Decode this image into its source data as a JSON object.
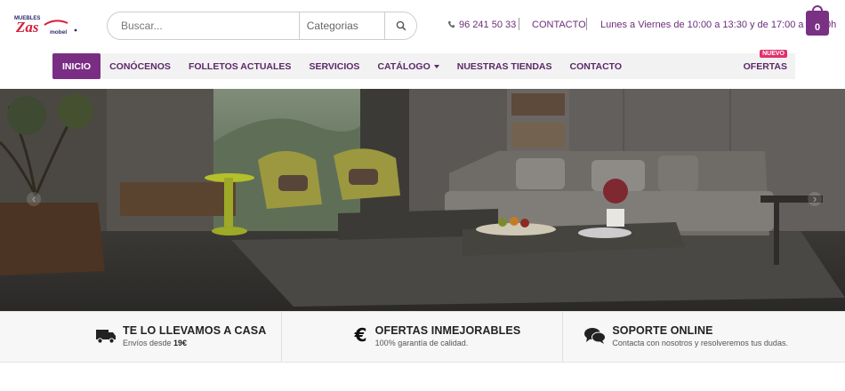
{
  "header": {
    "logo_text": "MUEBLES ZAS MOBEL",
    "search": {
      "placeholder": "Buscar...",
      "category_label": "Categorias"
    },
    "phone": "96 241 50 33",
    "contact_label": "CONTACTO",
    "hours": "Lunes a Viernes de 10:00 a 13:30 y de 17:00 a 20:30h",
    "cart_count": "0"
  },
  "nav": {
    "items": [
      {
        "label": "INICIO",
        "active": true
      },
      {
        "label": "CONÓCENOS"
      },
      {
        "label": "FOLLETOS ACTUALES"
      },
      {
        "label": "SERVICIOS"
      },
      {
        "label": "CATÁLOGO"
      },
      {
        "label": "NUESTRAS TIENDAS"
      },
      {
        "label": "CONTACTO"
      }
    ],
    "offers_label": "OFERTAS",
    "offers_badge": "NUEVO"
  },
  "features": [
    {
      "title": "TE LO LLEVAMOS A CASA",
      "subtitle": "Envíos desde ",
      "subtitle_bold": "19€",
      "icon": "truck-icon"
    },
    {
      "title": "OFERTAS INMEJORABLES",
      "subtitle": "100% garantía de calidad.",
      "icon": "euro-icon"
    },
    {
      "title": "SOPORTE ONLINE",
      "subtitle": "Contacta con nosotros y resolveremos tus dudas.",
      "icon": "chat-icon"
    }
  ],
  "colors": {
    "brand_purple": "#7a2e83",
    "nav_bg": "#f2f2f2",
    "badge_pink": "#e0316c"
  }
}
